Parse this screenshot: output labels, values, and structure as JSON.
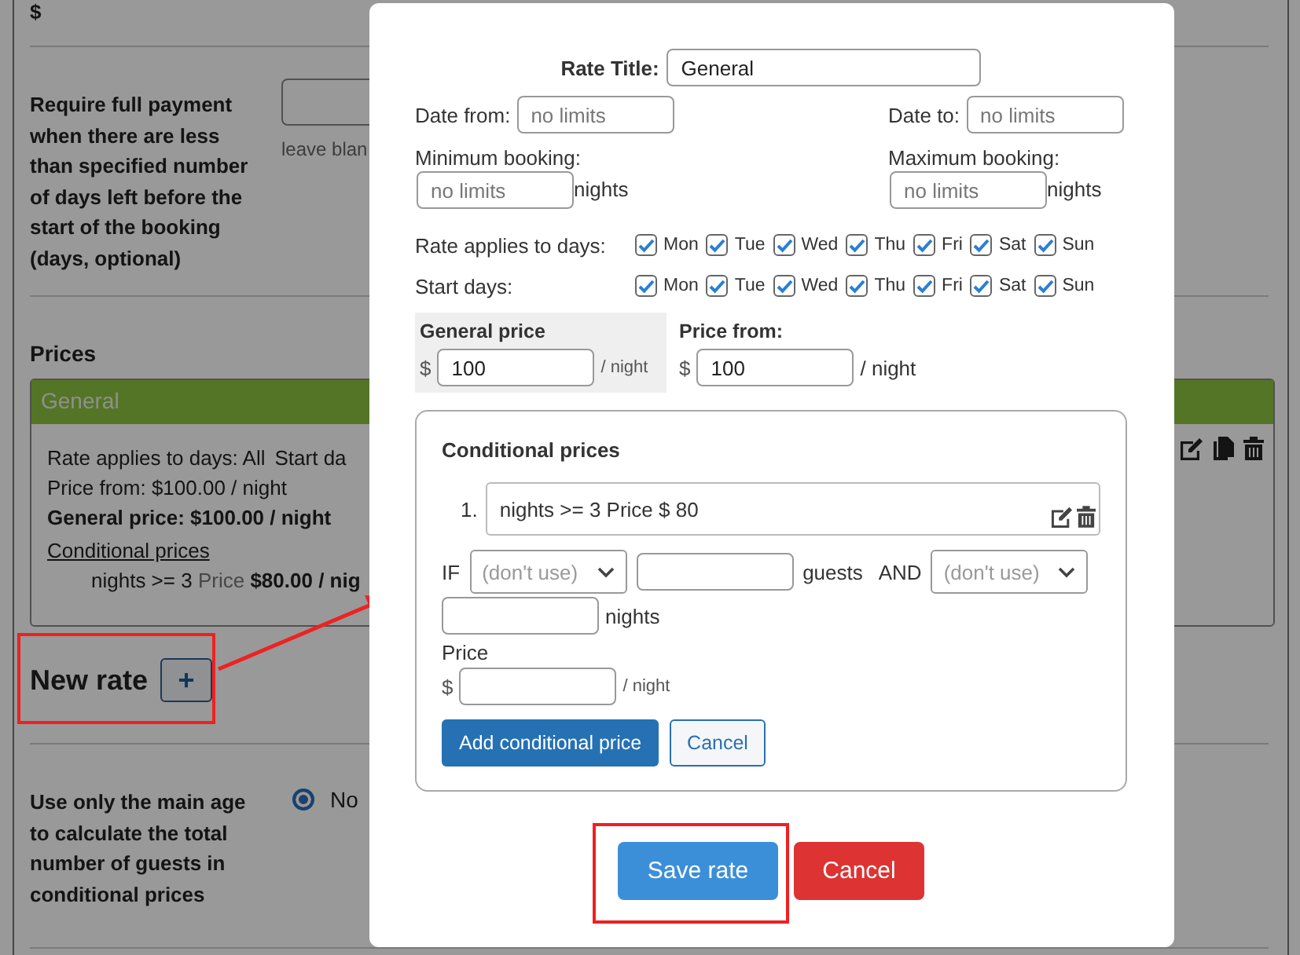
{
  "page": {
    "top_label": "$",
    "full_payment": {
      "label": "Require full payment when there are less than specified number of days left before the start of the booking (days, optional)",
      "hint": "leave blan"
    },
    "prices_heading": "Prices",
    "rate_card": {
      "title": "General",
      "days_line": "Rate applies to days: All",
      "start_days_line": "Start da",
      "price_from": "Price from: $100.00 / night",
      "general_price": "General price: $100.00 / night",
      "conditional_link": "Conditional prices",
      "condition": "nights >= 3",
      "price_label": "Price",
      "price": "$80.00 / nig"
    },
    "new_rate": {
      "label": "New rate",
      "button": "+"
    },
    "main_age": {
      "label": "Use only the main age to calculate the total number of guests in conditional prices",
      "option": "No",
      "selected": true
    }
  },
  "modal": {
    "rate_title": {
      "label": "Rate Title:",
      "value": "General"
    },
    "date_from": {
      "label": "Date from:",
      "placeholder": "no limits"
    },
    "date_to": {
      "label": "Date to:",
      "placeholder": "no limits"
    },
    "min_booking": {
      "label": "Minimum booking:",
      "placeholder": "no limits",
      "unit": "nights"
    },
    "max_booking": {
      "label": "Maximum booking:",
      "placeholder": "no limits",
      "unit": "nights"
    },
    "day_rows": [
      {
        "label": "Rate applies to days:",
        "days": [
          {
            "label": "Mon",
            "checked": true
          },
          {
            "label": "Tue",
            "checked": true
          },
          {
            "label": "Wed",
            "checked": true
          },
          {
            "label": "Thu",
            "checked": true
          },
          {
            "label": "Fri",
            "checked": true
          },
          {
            "label": "Sat",
            "checked": true
          },
          {
            "label": "Sun",
            "checked": true
          }
        ]
      },
      {
        "label": "Start days:",
        "days": [
          {
            "label": "Mon",
            "checked": true
          },
          {
            "label": "Tue",
            "checked": true
          },
          {
            "label": "Wed",
            "checked": true
          },
          {
            "label": "Thu",
            "checked": true
          },
          {
            "label": "Fri",
            "checked": true
          },
          {
            "label": "Sat",
            "checked": true
          },
          {
            "label": "Sun",
            "checked": true
          }
        ]
      }
    ],
    "general_price": {
      "heading": "General price",
      "currency": "$",
      "value": "100",
      "unit": "/ night"
    },
    "price_from": {
      "heading": "Price from:",
      "currency": "$",
      "value": "100",
      "unit": "/ night"
    },
    "conditional": {
      "heading": "Conditional prices",
      "items": [
        {
          "number": "1.",
          "text": "nights >= 3 Price $ 80"
        }
      ],
      "if_label": "IF",
      "guests_select": "(don't use)",
      "guests_label": "guests",
      "and_label": "AND",
      "nights_select": "(don't use)",
      "nights_label": "nights",
      "price_label": "Price",
      "currency": "$",
      "unit": "/ night",
      "add_button": "Add conditional price",
      "cancel_button": "Cancel"
    },
    "save_button": "Save rate",
    "cancel_button": "Cancel"
  }
}
